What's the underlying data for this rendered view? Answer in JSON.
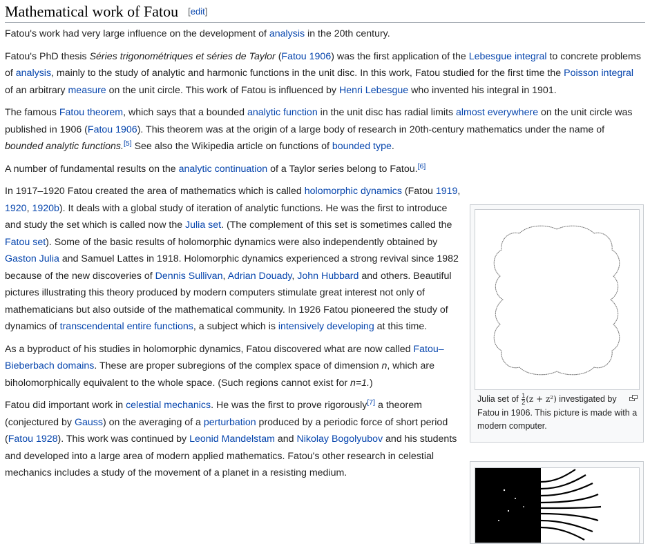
{
  "heading": {
    "title": "Mathematical work of Fatou",
    "edit": "edit"
  },
  "p1": {
    "t1": "Fatou's work had very large influence on the development of ",
    "l1": "analysis",
    "t2": " in the 20th century."
  },
  "p2": {
    "t1": "Fatou's PhD thesis ",
    "title_it": "Séries trigonométriques et séries de Taylor",
    "t2": " (",
    "l1": "Fatou 1906",
    "t3": ") was the first application of the ",
    "l2": "Lebesgue integral",
    "t4": " to concrete problems of ",
    "l3": "analysis",
    "t5": ", mainly to the study of analytic and harmonic functions in the unit disc. In this work, Fatou studied for the first time the ",
    "l4": "Poisson integral",
    "t6": " of an arbitrary ",
    "l5": "measure",
    "t7": " on the unit circle. This work of Fatou is influenced by ",
    "l6": "Henri Lebesgue",
    "t8": " who invented his integral in 1901."
  },
  "p3": {
    "t1": "The famous ",
    "l1": "Fatou theorem",
    "t2": ", which says that a bounded ",
    "l2": "analytic function",
    "t3": " in the unit disc has radial limits ",
    "l3": "almost everywhere",
    "t4": " on the unit circle was published in 1906 (",
    "l4": "Fatou 1906",
    "t5": "). This theorem was at the origin of a large body of research in 20th-century mathematics under the name of ",
    "it1": "bounded analytic functions.",
    "ref": "[5]",
    "t6": " See also the Wikipedia article on functions of ",
    "l5": "bounded type",
    "t7": "."
  },
  "p4": {
    "t1": "A number of fundamental results on the ",
    "l1": "analytic continuation",
    "t2": " of a Taylor series belong to Fatou.",
    "ref": "[6]"
  },
  "p5": {
    "t1": "In 1917–1920 Fatou created the area of mathematics which is called ",
    "l1": "holomorphic dynamics",
    "t2": " (Fatou ",
    "l2": "1919",
    "c1": ", ",
    "l3": "1920",
    "c2": ", ",
    "l4": "1920b",
    "t3": "). It deals with a global study of iteration of analytic functions. He was the first to introduce and study the set which is called now the ",
    "l5": "Julia set",
    "t4": ". (The complement of this set is sometimes called the ",
    "l6": "Fatou set",
    "t5": "). Some of the basic results of holomorphic dynamics were also independently obtained by ",
    "l7": "Gaston Julia",
    "t6": " and Samuel Lattes in 1918. Holomorphic dynamics experienced a strong revival since 1982 because of the new discoveries of ",
    "l8": "Dennis Sullivan",
    "c3": ", ",
    "l9": "Adrian Douady",
    "c4": ", ",
    "l10": "John Hubbard",
    "t7": " and others. Beautiful pictures illustrating this theory produced by modern computers stimulate great interest not only of mathematicians but also outside of the mathematical community. In 1926 Fatou pioneered the study of dynamics of ",
    "l11": "transcendental entire functions",
    "t8": ", a subject which is ",
    "l12": "intensively developing",
    "t9": " at this time."
  },
  "p6": {
    "t1": "As a byproduct of his studies in holomorphic dynamics, Fatou discovered what are now called ",
    "l1": "Fatou–Bieberbach domains",
    "t2": ". These are proper subregions of the complex space of dimension ",
    "it1": "n",
    "t3": ", which are biholomorphically equivalent to the whole space. (Such regions cannot exist for ",
    "it2": "n=1.",
    "t4": ")"
  },
  "p7": {
    "t1": "Fatou did important work in ",
    "l1": "celestial mechanics",
    "t2": ". He was the first to prove rigorously",
    "ref": "[7]",
    "t3": " a theorem (conjectured by ",
    "l2": "Gauss",
    "t4": ") on the averaging of a ",
    "l3": "perturbation",
    "t5": " produced by a periodic force of short period (",
    "l4": "Fatou 1928",
    "t6": "). This work was continued by ",
    "l5": "Leonid Mandelstam",
    "t7": " and ",
    "l6": "Nikolay Bogolyubov",
    "t8": " and his students and developed into a large area of modern applied mathematics. Fatou's other research in celestial mechanics includes a study of the movement of a planet in a resisting medium."
  },
  "thumb1": {
    "cap_pre": "Julia set of ",
    "frac_num": "1",
    "frac_den": "2",
    "formula": "(z + z²)",
    "cap_post": " investigated by Fatou in 1906. This picture is made with a modern computer."
  },
  "icons": {
    "enlarge": "enlarge-icon",
    "julia": "julia-set-image",
    "fractal": "exponential-fractal-image"
  }
}
